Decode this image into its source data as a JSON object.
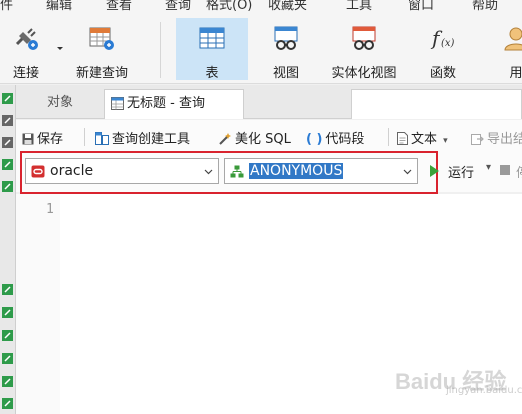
{
  "menu": [
    "件",
    "编辑",
    "查看",
    "查询",
    "格式(O)",
    "收藏夹",
    "工具",
    "窗口",
    "帮助"
  ],
  "toolbar": {
    "connect": "连接",
    "new_query": "新建查询",
    "table": "表",
    "view": "视图",
    "materialized_view": "实体化视图",
    "function": "函数",
    "user": "用"
  },
  "tabs": {
    "objects": "对象",
    "query": "无标题 - 查询"
  },
  "toolbar2": {
    "save": "保存",
    "query_builder": "查询创建工具",
    "beautify": "美化 SQL",
    "code_snippet": "代码段",
    "text": "文本",
    "export": "导出结"
  },
  "connection": {
    "name": "oracle",
    "schema": "ANONYMOUS",
    "run": "运行",
    "stop": "停"
  },
  "editor": {
    "line_numbers": [
      "1"
    ]
  },
  "watermark": {
    "brand": "Baidu 经验",
    "url": "jingyan.baidu.com"
  },
  "colors": {
    "highlight_border": "#d9232e",
    "selection": "#3178c6",
    "run_green": "#3aa13a",
    "oracle_red": "#d32f2f",
    "schema_green": "#3a9a3a"
  }
}
